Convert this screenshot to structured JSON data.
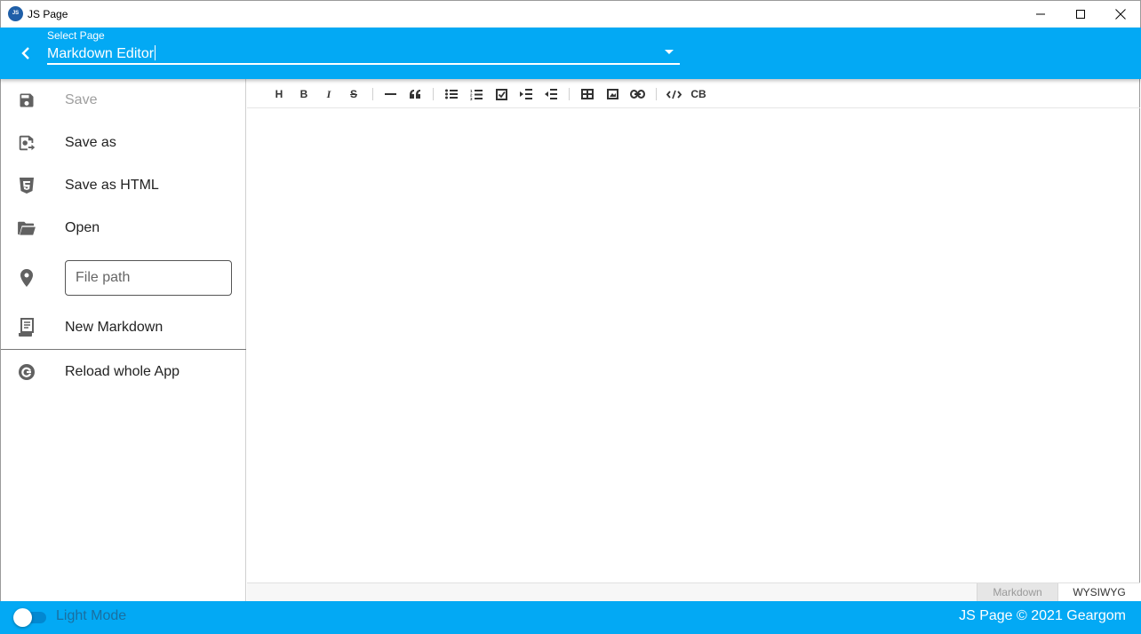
{
  "window": {
    "title": "JS Page",
    "icon_text": "JS"
  },
  "appbar": {
    "select_label": "Select Page",
    "select_value": "Markdown Editor"
  },
  "sidebar": {
    "items": [
      {
        "label": "Save",
        "icon": "save-icon",
        "disabled": true
      },
      {
        "label": "Save as",
        "icon": "save-as-icon"
      },
      {
        "label": "Save as HTML",
        "icon": "html5-icon"
      },
      {
        "label": "Open",
        "icon": "folder-open-icon"
      },
      {
        "label": "New Markdown",
        "icon": "document-icon"
      },
      {
        "label": "Reload whole App",
        "icon": "reload-icon"
      }
    ],
    "path_placeholder": "File path",
    "path_icon": "location-pin-icon"
  },
  "toolbar": {
    "heading": "H",
    "bold": "B",
    "italic": "I",
    "strike": "S",
    "codeblock": "CB"
  },
  "editor": {
    "mode_markdown": "Markdown",
    "mode_wysiwyg": "WYSIWYG",
    "active_mode": "WYSIWYG"
  },
  "footer": {
    "theme_label": "Light Mode",
    "theme_dark": false,
    "copyright": "JS Page © 2021 Geargom"
  },
  "colors": {
    "primary": "#03a9f4",
    "toggle_track": "#0288d1"
  }
}
